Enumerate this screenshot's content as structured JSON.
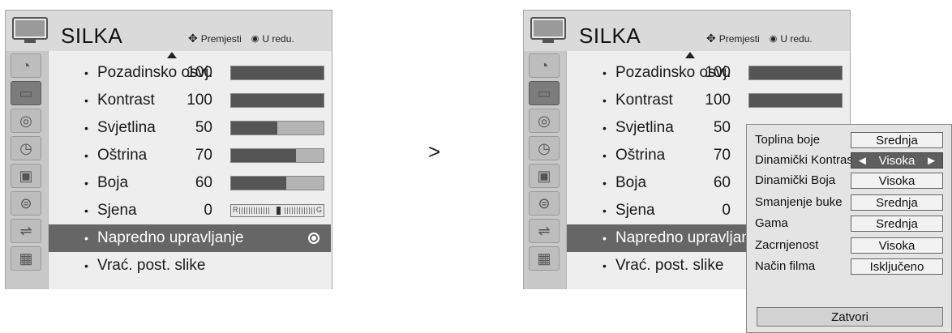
{
  "left_panel": {
    "title": "SILKA",
    "hint_move": "Premjesti",
    "hint_ok": "U redu.",
    "rows": [
      {
        "label": "Pozadinsko osvj.",
        "value": "100",
        "level": 1.0
      },
      {
        "label": "Kontrast",
        "value": "100",
        "level": 1.0
      },
      {
        "label": "Svjetlina",
        "value": "50",
        "level": 0.5
      },
      {
        "label": "Oštrina",
        "value": "70",
        "level": 0.7
      },
      {
        "label": "Boja",
        "value": "60",
        "level": 0.6
      },
      {
        "label": "Sjena",
        "value": "0"
      },
      {
        "label": "Napredno upravljanje"
      },
      {
        "label": "Vrać. post. slike"
      }
    ],
    "tint": {
      "left": "R",
      "right": "G"
    }
  },
  "separator": ">",
  "right_panel": {
    "title": "SILKA",
    "hint_move": "Premjesti",
    "hint_ok": "U redu.",
    "rows": [
      {
        "label": "Pozadinsko osvj.",
        "value": "100",
        "level": 1.0
      },
      {
        "label": "Kontrast",
        "value": "100",
        "level": 1.0
      },
      {
        "label": "Svjetlina",
        "value": "50"
      },
      {
        "label": "Oštrina",
        "value": "70"
      },
      {
        "label": "Boja",
        "value": "60"
      },
      {
        "label": "Sjena",
        "value": "0"
      },
      {
        "label": "Napredno upravljanje"
      },
      {
        "label": "Vrać. post. slike"
      }
    ]
  },
  "popup": {
    "rows": [
      {
        "label": "Toplina boje",
        "value": "Srednja"
      },
      {
        "label": "Dinamički Kontrast",
        "value": "Visoka",
        "left_arrow": "◄",
        "right_arrow": "►"
      },
      {
        "label": "Dinamički Boja",
        "value": "Visoka"
      },
      {
        "label": "Smanjenje buke",
        "value": "Srednja"
      },
      {
        "label": "Gama",
        "value": "Srednja"
      },
      {
        "label": "Zacrnjenost",
        "value": "Visoka"
      },
      {
        "label": "Način filma",
        "value": "Isključeno"
      }
    ],
    "close_label": "Zatvori"
  },
  "icons": [
    "tv-icon",
    "satellite-icon",
    "picture-icon",
    "audio-icon",
    "clock-icon",
    "option-icon",
    "lock-icon",
    "input-icon",
    "photo-icon"
  ],
  "colors": {
    "panel": "#dadada",
    "content": "#eeeeee",
    "selected": "#666666",
    "bar_fill": "#555555"
  }
}
